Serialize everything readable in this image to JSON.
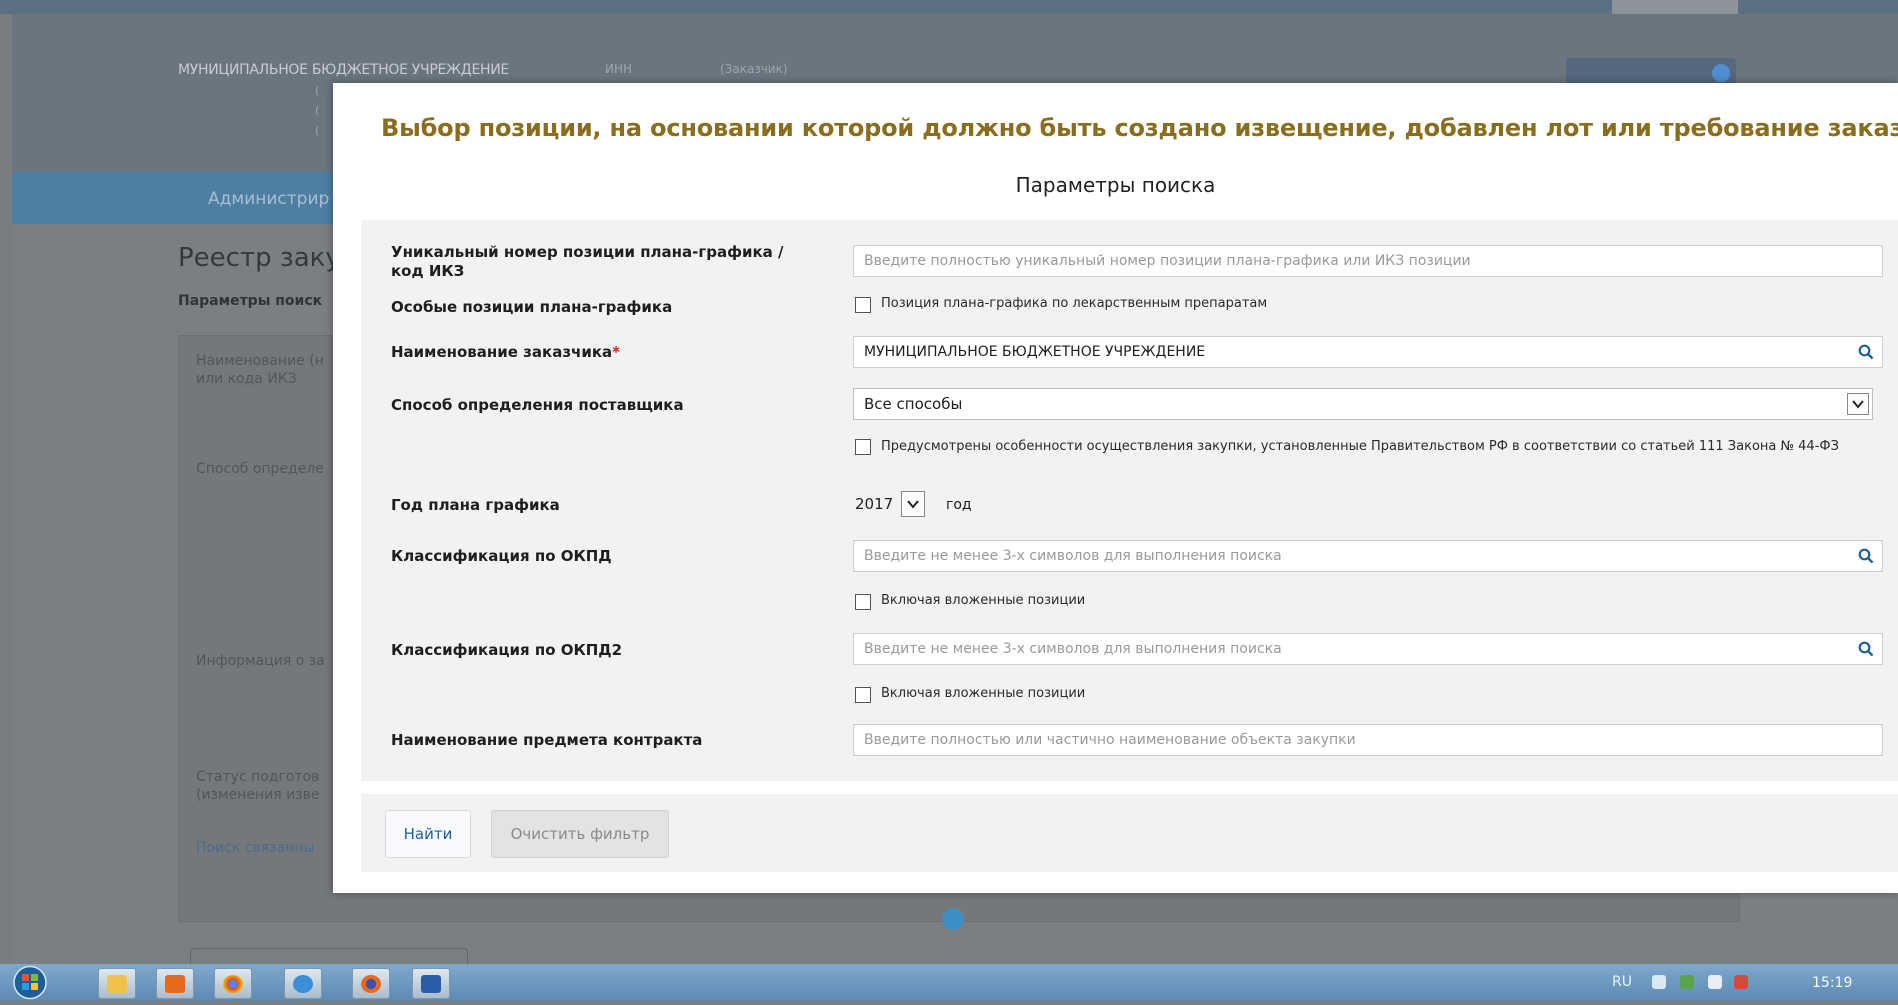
{
  "background": {
    "org_name": "МУНИЦИПАЛЬНОЕ БЮДЖЕТНОЕ УЧРЕЖДЕНИЕ",
    "inn_label": "ИНН",
    "inn_value": "(Заказчик)",
    "nav_item": "Администрир",
    "page_title": "Реестр заку",
    "params_label": "Параметры поиск",
    "field_name": "Наименование (н или кода ИКЗ",
    "field_method": "Способ определе",
    "field_info": "Информация о за",
    "field_status": "Статус подготов (изменения изве",
    "link_related": "Поиск связанны"
  },
  "modal": {
    "title": "Выбор позиции, на основании которой должно быть создано извещение, добавлен лот или требование заказчика",
    "subtitle": "Параметры поиска",
    "fields": {
      "unique_number": {
        "label": "Уникальный номер позиции плана-графика / код ИКЗ",
        "placeholder": "Введите полностью уникальный номер позиции плана-графика или ИКЗ позиции"
      },
      "special_positions": {
        "label": "Особые позиции плана-графика",
        "checkbox": "Позиция плана-графика по лекарственным препаратам"
      },
      "customer_name": {
        "label": "Наименование заказчика",
        "required_mark": "*",
        "value": "МУНИЦИПАЛЬНОЕ БЮДЖЕТНОЕ УЧРЕЖДЕНИЕ"
      },
      "supplier_method": {
        "label": "Способ определения поставщика",
        "value": "Все способы",
        "checkbox": "Предусмотрены особенности осуществления закупки, установленные Правительством РФ в соответствии со статьей 111 Закона № 44-ФЗ"
      },
      "plan_year": {
        "label": "Год плана графика",
        "value": "2017",
        "unit": "год"
      },
      "okpd": {
        "label": "Классификация по ОКПД",
        "placeholder": "Введите не менее 3-х символов для выполнения поиска",
        "checkbox": "Включая вложенные позиции"
      },
      "okpd2": {
        "label": "Классификация по ОКПД2",
        "placeholder": "Введите не менее 3-х символов для выполнения поиска",
        "checkbox": "Включая вложенные позиции"
      },
      "contract_subject": {
        "label": "Наименование предмета контракта",
        "placeholder": "Введите полностью или частично наименование объекта закупки"
      }
    },
    "buttons": {
      "find": "Найти",
      "clear": "Очистить фильтр"
    }
  },
  "taskbar": {
    "language": "RU",
    "time": "15:19"
  },
  "colors": {
    "title": "#8b6d1f",
    "required": "#cc2222",
    "link_button": "#1d5f9e",
    "search_icon": "#1d5f9e"
  },
  "icons": [
    "search-icon",
    "chevron-down-icon",
    "windows-start-icon",
    "explorer-icon",
    "media-player-icon",
    "chrome-icon",
    "ie-icon",
    "firefox-icon",
    "word-icon"
  ]
}
